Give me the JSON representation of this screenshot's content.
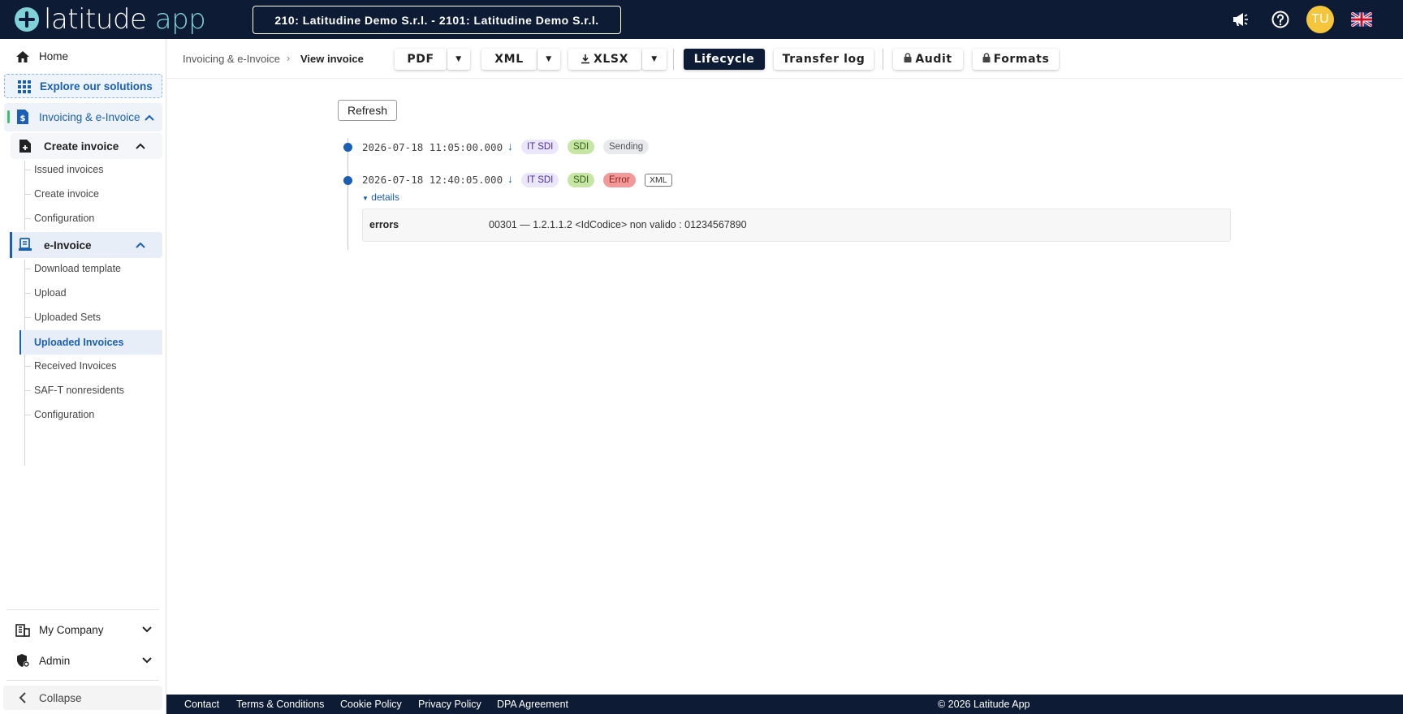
{
  "app": {
    "logo_part1": "latitude",
    "logo_part2": "app",
    "company_selector": "210: Latitudine Demo S.r.l. - 2101: Latitudine Demo S.r.l.",
    "avatar_initials": "TU",
    "icons": [
      "megaphone-icon",
      "help-icon",
      "uk-flag-icon"
    ]
  },
  "sidebar": {
    "home": "Home",
    "explore": "Explore our solutions",
    "invoicing": "Invoicing & e-Invoice",
    "create_invoice_group": "Create invoice",
    "create_invoice_items": [
      "Issued invoices",
      "Create invoice",
      "Configuration"
    ],
    "einvoice_group": "e-Invoice",
    "einvoice_items": [
      "Download template",
      "Upload",
      "Uploaded Sets",
      "Uploaded Invoices",
      "Received Invoices",
      "SAF-T nonresidents",
      "Configuration"
    ],
    "active_item": "Uploaded Invoices",
    "my_company": "My Company",
    "admin": "Admin",
    "collapse": "Collapse"
  },
  "breadcrumb": {
    "parent": "Invoicing & e-Invoice",
    "separator": "›",
    "current": "View invoice"
  },
  "toolbar": {
    "pdf": "PDF",
    "xml": "XML",
    "xlsx": "XLSX",
    "caret": "▼",
    "lifecycle": "Lifecycle",
    "transfer_log": "Transfer log",
    "audit": "Audit",
    "formats": "Formats"
  },
  "content": {
    "refresh": "Refresh",
    "events": [
      {
        "timestamp": "2026-07-18 11:05:00.000",
        "arrow": "↓",
        "channel": "IT SDI",
        "system": "SDI",
        "status": "Sending",
        "status_color": "#e8eaee"
      },
      {
        "timestamp": "2026-07-18 12:40:05.000",
        "arrow": "↓",
        "channel": "IT SDI",
        "system": "SDI",
        "status": "Error",
        "status_color": "#f29a9a",
        "attachment": "XML"
      }
    ],
    "details_toggle": "details",
    "error_key": "errors",
    "error_value": "00301 — 1.2.1.1.2 <IdCodice> non valido : 01234567890"
  },
  "footer": {
    "links": [
      "Contact",
      "Terms & Conditions",
      "Cookie Policy",
      "Privacy Policy",
      "DPA Agreement"
    ],
    "copyright": "© 2026 Latitude App"
  },
  "colors": {
    "navy": "#0d1b34",
    "accent_blue": "#1a5fb4",
    "logo_teal": "#7fd3d8",
    "avatar": "#f5c63b",
    "active_marker": "#3cc46c"
  }
}
